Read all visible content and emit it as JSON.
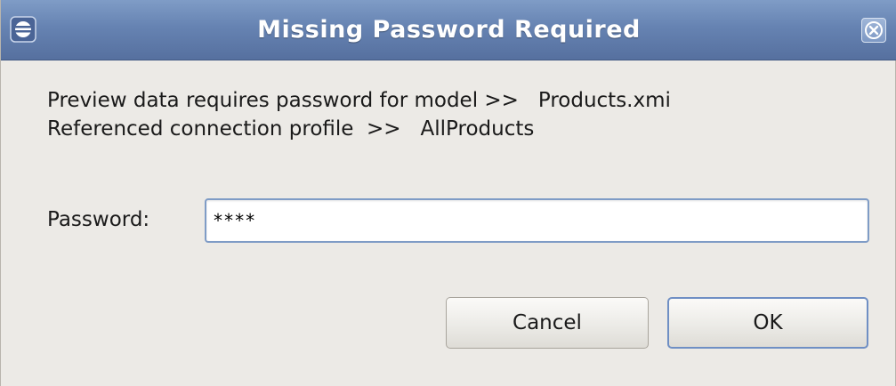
{
  "window": {
    "title": "Missing Password Required",
    "icons": {
      "app": "window-menu-icon",
      "close": "close-icon"
    }
  },
  "message": {
    "line1": "Preview data requires password for model >>   Products.xmi",
    "line2": "Referenced connection profile  >>   AllProducts"
  },
  "form": {
    "password_label": "Password:",
    "password_value": "****"
  },
  "buttons": {
    "cancel": "Cancel",
    "ok": "OK"
  },
  "colors": {
    "titlebar": "#6683b2",
    "dialog_background": "#eceae6",
    "focus_border": "#7f9cc6"
  }
}
